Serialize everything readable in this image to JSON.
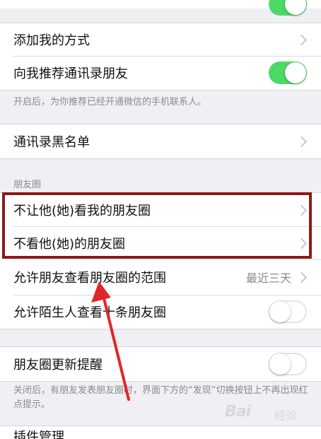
{
  "rows": {
    "add_me_methods": "添加我的方式",
    "recommend_contacts": "向我推荐通讯录朋友",
    "recommend_note": "开启后，为你推荐已经开通微信的手机联系人。",
    "contacts_blacklist": "通讯录黑名单",
    "moments_header": "朋友圈",
    "hide_my_moments": "不让他(她)看我的朋友圈",
    "hide_their_moments": "不看他(她)的朋友圈",
    "allow_view_range": "允许朋友查看朋友圈的范围",
    "allow_view_range_value": "最近三天",
    "allow_strangers": "允许陌生人查看十条朋友圈",
    "moments_update_reminder": "朋友圈更新提醒",
    "reminder_note": "关闭后，有朋友发表朋友圈时，界面下方的“发现”切换按钮上不再出现红点提示。",
    "bottom_partial": "插件管理"
  },
  "toggles": {
    "top_partial": true,
    "recommend_contacts": true,
    "allow_strangers": false,
    "moments_update_reminder": false
  },
  "watermark": {
    "brand": "Bai",
    "sub": "经验"
  },
  "colors": {
    "toggle_on": "#4cd964",
    "highlight_border": "#8b1a1a",
    "arrow": "#e0262b"
  }
}
